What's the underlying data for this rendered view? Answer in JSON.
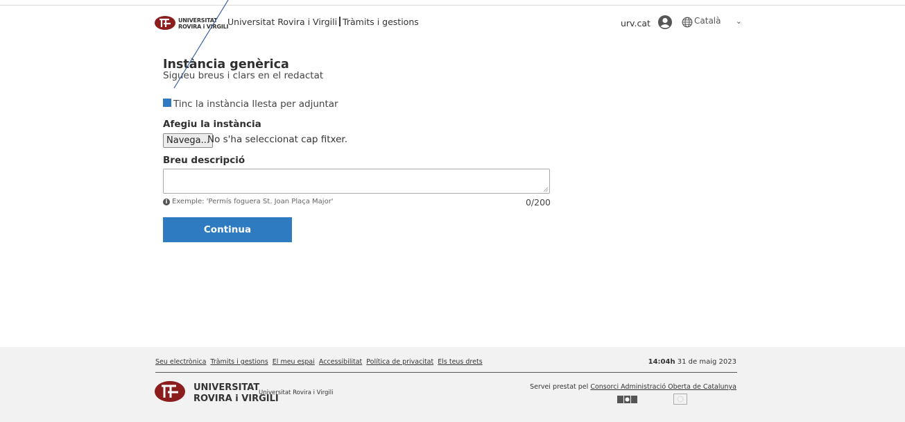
{
  "header": {
    "logo_text_line1": "UNIVERSITAT",
    "logo_text_line2": "ROVIRA i VIRGILI",
    "site_name": "Universitat Rovira i Virgili",
    "section": "Tràmits i gestions",
    "urv_link": "urv.cat",
    "language": "Català"
  },
  "form": {
    "title": "Instància genèrica",
    "subtitle": "Sigueu breus i clars en el redactat",
    "checkbox_label": "Tinc la instància llesta per adjuntar",
    "attach_label": "Afegiu la instància",
    "browse_button": "Navega...",
    "no_file_text": "No s'ha seleccionat cap fitxer.",
    "desc_label": "Breu descripció",
    "desc_value": "",
    "hint": "Exemple: 'Permís foguera St. Joan Plaça Major'",
    "counter": "0/200",
    "continue_button": "Continua"
  },
  "footer": {
    "links": [
      "Seu electrònica",
      "Tràmits i gestions",
      "El meu espai",
      "Accessibilitat",
      "Política de privacitat",
      "Els teus drets"
    ],
    "time": "14:04h",
    "date": "31 de maig 2023",
    "logo_line1": "UNIVERSITAT",
    "logo_line2": "ROVIRA i VIRGILI",
    "logo_sub": "Universitat Rovira i Virgili",
    "service_prefix": "Servei prestat pel",
    "service_link": "Consorci Administració Oberta de Catalunya"
  },
  "colors": {
    "accent": "#2e7bc2",
    "footer_bg": "#f2f2f2",
    "logo_red": "#8b1d1d"
  },
  "icons": {
    "user": "user-circle-icon",
    "language": "globe-icon",
    "dropdown": "chevron-down-icon",
    "info": "info-icon"
  }
}
